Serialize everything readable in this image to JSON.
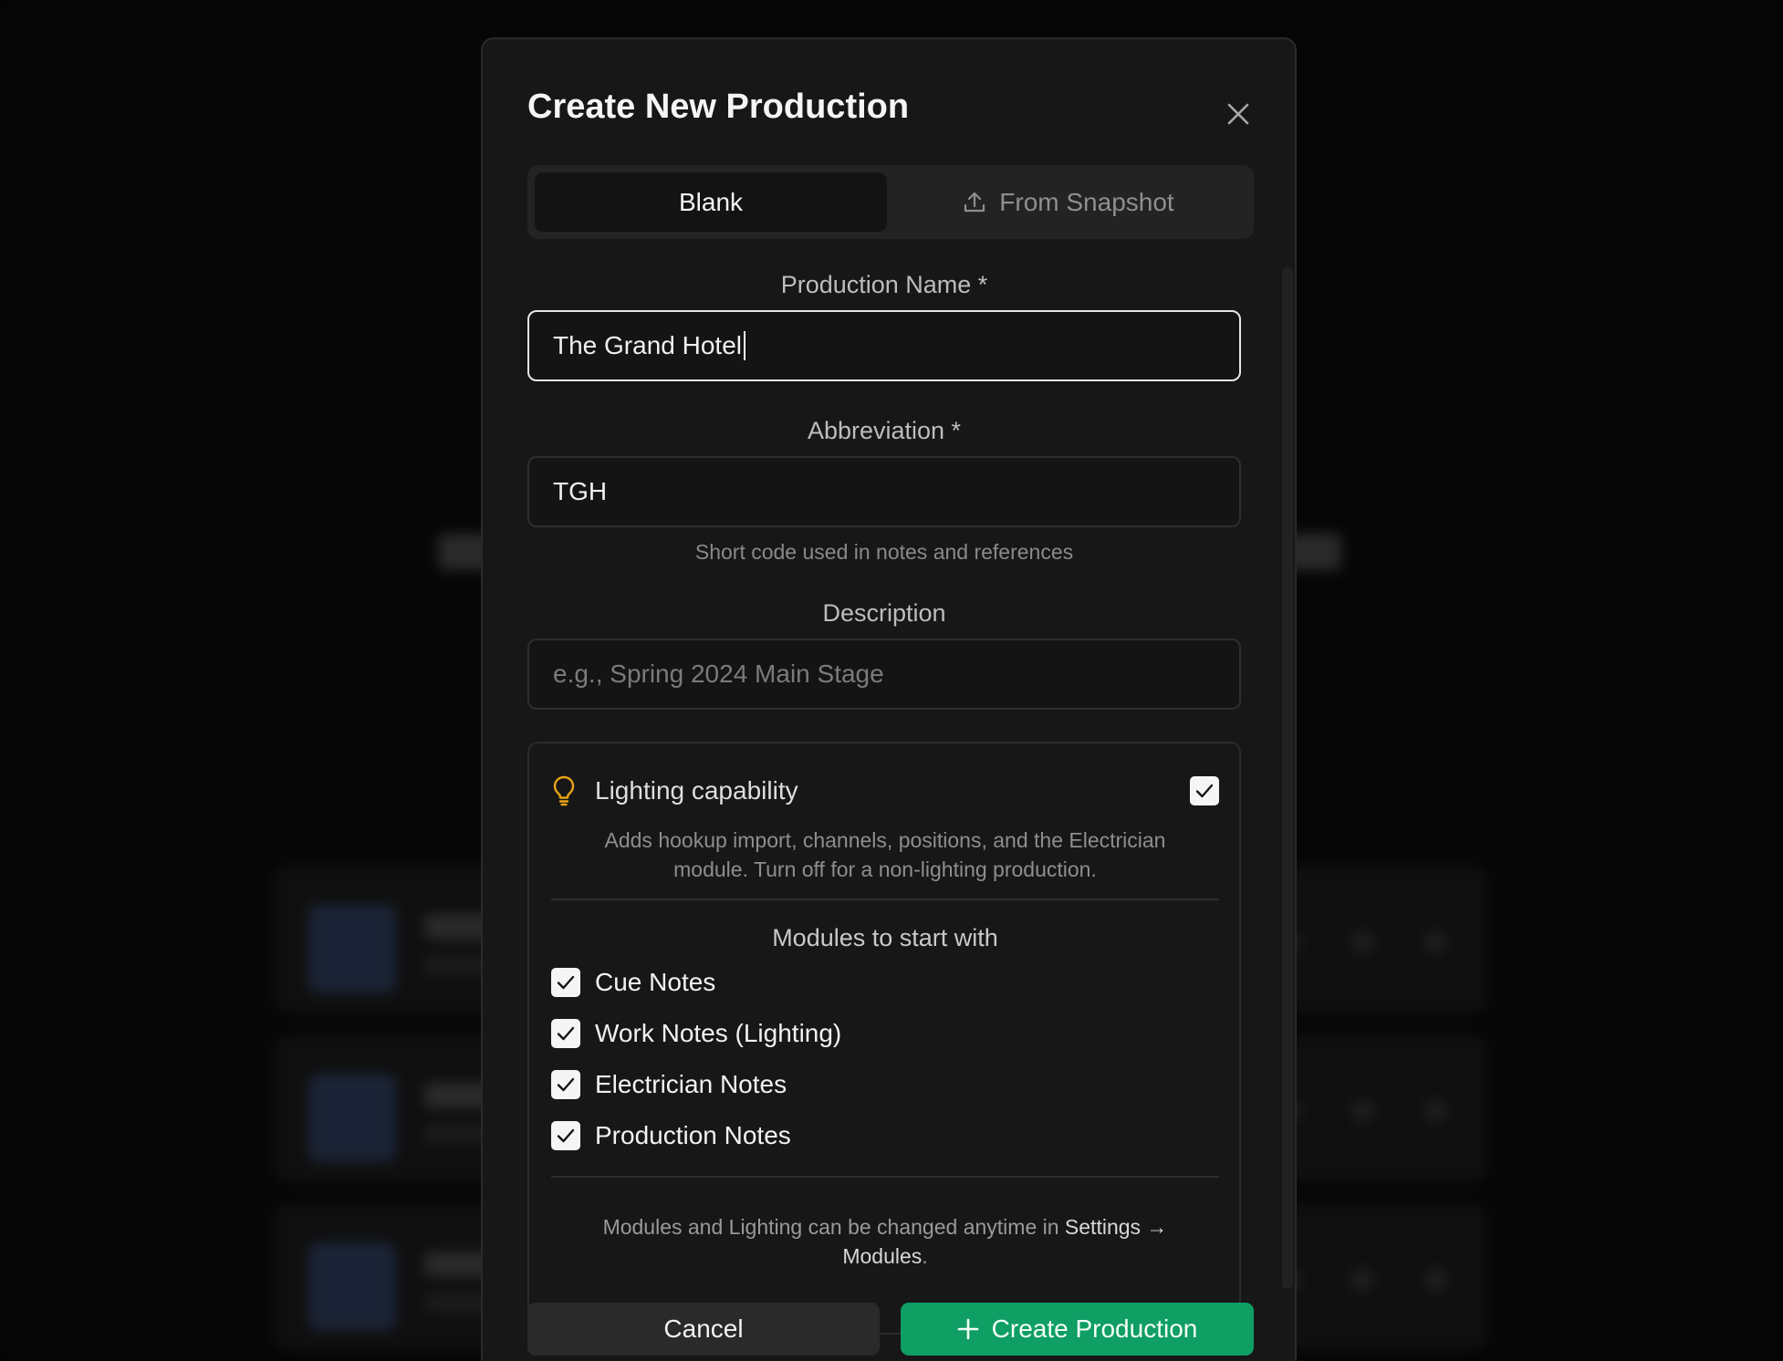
{
  "dialog": {
    "title": "Create New Production",
    "tabs": [
      {
        "label": "Blank",
        "selected": true
      },
      {
        "label": "From Snapshot",
        "selected": false,
        "icon": "upload-icon"
      }
    ]
  },
  "form": {
    "production_name": {
      "label": "Production Name *",
      "value": "The Grand Hotel"
    },
    "abbreviation": {
      "label": "Abbreviation *",
      "value": "TGH",
      "hint": "Short code used in notes and references"
    },
    "description": {
      "label": "Description",
      "value": "",
      "placeholder": "e.g., Spring 2024 Main Stage"
    }
  },
  "lighting": {
    "label": "Lighting capability",
    "icon": "lightbulb-icon",
    "checked": true,
    "description_line1": "Adds hookup import, channels, positions, and the Electrician",
    "description_line2": "module. Turn off for a non-lighting production."
  },
  "modules": {
    "title": "Modules to start with",
    "items": [
      {
        "label": "Cue Notes",
        "checked": true
      },
      {
        "label": "Work Notes (Lighting)",
        "checked": true
      },
      {
        "label": "Electrician Notes",
        "checked": true
      },
      {
        "label": "Production Notes",
        "checked": true
      }
    ]
  },
  "footer_note": {
    "prefix": "Modules and Lighting can be changed anytime in",
    "settings": "Settings",
    "arrow": "→",
    "modules": "Modules",
    "period": "."
  },
  "buttons": {
    "cancel": "Cancel",
    "create": "Create Production"
  },
  "colors": {
    "accent": "#0f9e64",
    "bulb": "#e8a317",
    "dialog_bg": "#171717"
  }
}
